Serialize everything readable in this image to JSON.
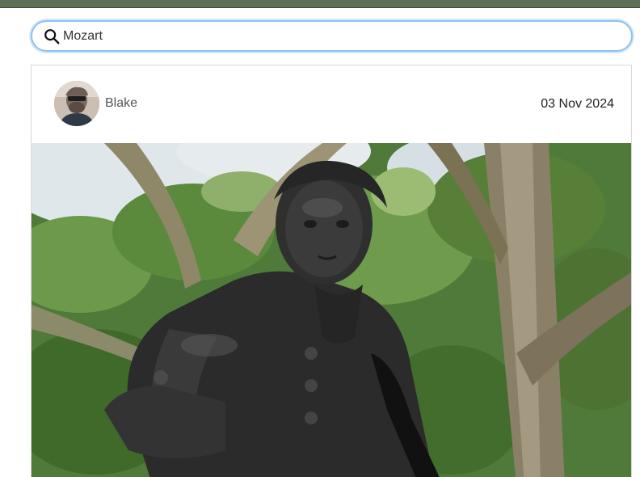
{
  "search": {
    "value": "Mozart",
    "icon": "search-icon"
  },
  "post": {
    "author_name": "Blake",
    "date": "03 Nov 2024",
    "avatar_icon": "avatar"
  },
  "colors": {
    "top_bar": "#5d6f55",
    "search_border": "#8fc0f0",
    "card_border": "#d9d9d9"
  }
}
